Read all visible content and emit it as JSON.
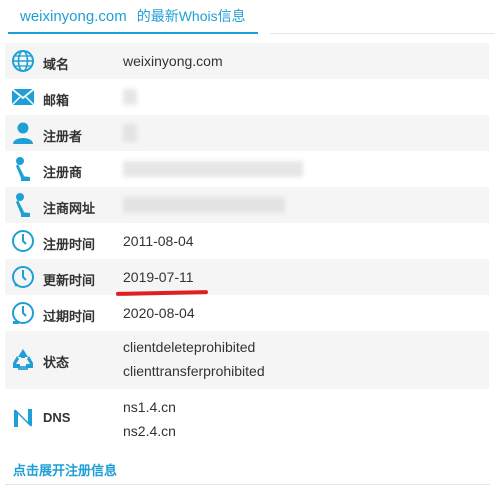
{
  "header": {
    "domain": "weixinyong.com",
    "suffix": "的最新Whois信息"
  },
  "rows": [
    {
      "icon": "globe-icon",
      "label": "域名",
      "value": "weixinyong.com"
    },
    {
      "icon": "mail-icon",
      "label": "邮箱",
      "value": ""
    },
    {
      "icon": "person-icon",
      "label": "注册者",
      "value": ""
    },
    {
      "icon": "registrar-icon",
      "label": "注册商",
      "value": ""
    },
    {
      "icon": "registrar-url-icon",
      "label": "注商网址",
      "value": ""
    },
    {
      "icon": "clock-icon",
      "label": "注册时间",
      "value": "2011-08-04"
    },
    {
      "icon": "clock-refresh-icon",
      "label": "更新时间",
      "value": "2019-07-11"
    },
    {
      "icon": "clock-expire-icon",
      "label": "过期时间",
      "value": "2020-08-04"
    },
    {
      "icon": "recycle-icon",
      "label": "状态",
      "values": [
        "clientdeleteprohibited",
        "clienttransferprohibited"
      ]
    },
    {
      "icon": "dns-icon",
      "label": "DNS",
      "values": [
        "ns1.4.cn",
        "ns2.4.cn"
      ]
    }
  ],
  "footer": {
    "expand_link": "点击展开注册信息"
  },
  "colors": {
    "accent": "#1e9fd6",
    "highlight": "#e02020",
    "row_shade": "#f5f5f5"
  }
}
